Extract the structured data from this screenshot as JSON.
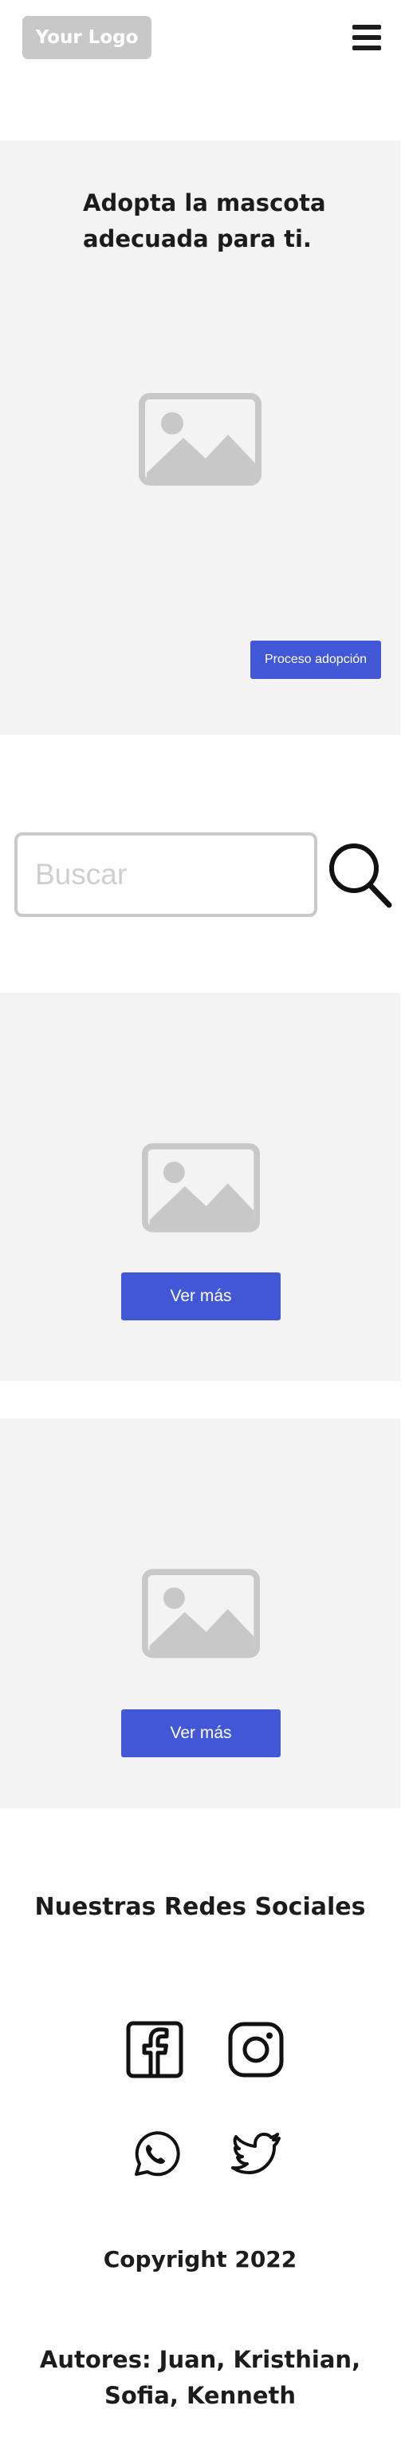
{
  "header": {
    "logo_text": "Your Logo",
    "menu_icon": "hamburger-menu-icon"
  },
  "hero": {
    "title": "Adopta la mascota adecuada para ti.",
    "image_icon": "image-placeholder-icon",
    "button_label": "Proceso adopción"
  },
  "search": {
    "placeholder": "Buscar",
    "button_icon": "magnifier-icon"
  },
  "cards": [
    {
      "image_icon": "image-placeholder-icon",
      "button_label": "Ver más"
    },
    {
      "image_icon": "image-placeholder-icon",
      "button_label": "Ver más"
    }
  ],
  "social": {
    "title": "Nuestras Redes Sociales",
    "icons": [
      "facebook-icon",
      "instagram-icon",
      "whatsapp-icon",
      "twitter-icon"
    ]
  },
  "footer": {
    "copyright": "Copyright 2022",
    "authors": "Autores: Juan, Kristhian, Sofia, Kenneth"
  },
  "colors": {
    "accent": "#4257d6",
    "panel_background": "#f3f3f4",
    "placeholder_gray": "#c8c8c8",
    "text": "#1c1c1c"
  }
}
